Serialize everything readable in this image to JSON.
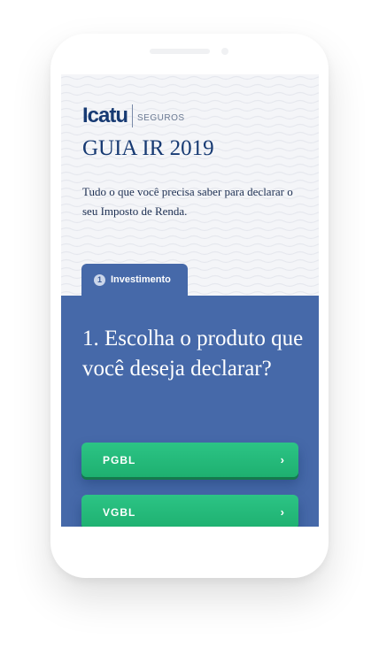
{
  "brand": {
    "name": "Icatu",
    "suffix": "SEGUROS"
  },
  "page": {
    "title": "GUIA IR 2019",
    "intro": "Tudo o que você precisa saber para declarar o seu Imposto de Renda."
  },
  "step_tab": {
    "number": "1",
    "label": "Investimento"
  },
  "question": "1. Escolha o produto que você deseja declarar?",
  "options": [
    {
      "label": "PGBL",
      "arrow": "›"
    },
    {
      "label": "VGBL",
      "arrow": "›"
    }
  ],
  "colors": {
    "navy": "#173a73",
    "panel_blue": "#4669a9",
    "button_green": "#24b97a",
    "background": "#f4f5f8"
  },
  "icons": [
    "chevron-right-icon",
    "step-number-badge"
  ]
}
